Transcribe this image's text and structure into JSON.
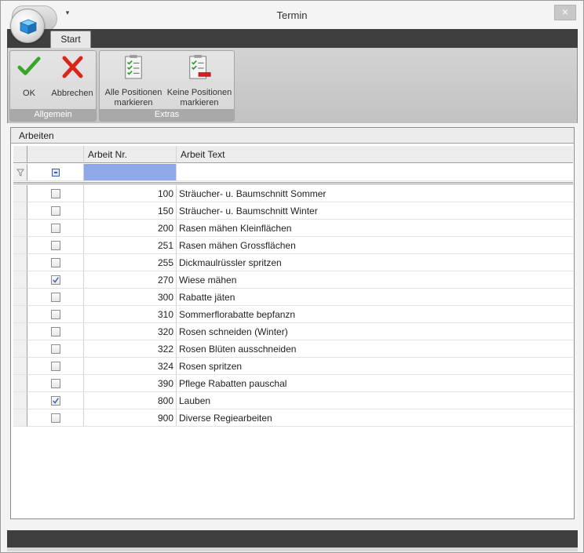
{
  "window": {
    "title": "Termin",
    "close_glyph": "×",
    "qat_glyph": "▾"
  },
  "ribbon": {
    "tabs": [
      {
        "label": "Start"
      }
    ],
    "groups": [
      {
        "caption": "Allgemein",
        "buttons": [
          {
            "label": "OK",
            "icon": "check-icon"
          },
          {
            "label": "Abbrechen",
            "icon": "cross-icon"
          }
        ]
      },
      {
        "caption": "Extras",
        "buttons": [
          {
            "label": "Alle Positionen markieren",
            "line1": "Alle Positionen",
            "line2": "markieren",
            "icon": "checklist-icon"
          },
          {
            "label": "Keine Positionen markieren",
            "line1": "Keine Positionen",
            "line2": "markieren",
            "icon": "checklist-minus-icon"
          }
        ]
      }
    ]
  },
  "panel": {
    "title": "Arbeiten"
  },
  "grid": {
    "columns": [
      "",
      "",
      "Arbeit Nr.",
      "Arbeit Text"
    ],
    "rows": [
      {
        "nr": "100",
        "text": "Sträucher- u. Baumschnitt Sommer",
        "checked": false
      },
      {
        "nr": "150",
        "text": "Sträucher- u. Baumschnitt Winter",
        "checked": false
      },
      {
        "nr": "200",
        "text": "Rasen mähen Kleinflächen",
        "checked": false
      },
      {
        "nr": "251",
        "text": "Rasen mähen Grossflächen",
        "checked": false
      },
      {
        "nr": "255",
        "text": "Dickmaulrüssler spritzen",
        "checked": false
      },
      {
        "nr": "270",
        "text": "Wiese mähen",
        "checked": true
      },
      {
        "nr": "300",
        "text": "Rabatte jäten",
        "checked": false
      },
      {
        "nr": "310",
        "text": "Sommerflorabatte bepfanzn",
        "checked": false
      },
      {
        "nr": "320",
        "text": "Rosen schneiden (Winter)",
        "checked": false
      },
      {
        "nr": "322",
        "text": "Rosen Blüten ausschneiden",
        "checked": false
      },
      {
        "nr": "324",
        "text": "Rosen spritzen",
        "checked": false
      },
      {
        "nr": "390",
        "text": "Pflege Rabatten pauschal",
        "checked": false
      },
      {
        "nr": "800",
        "text": "Lauben",
        "checked": true
      },
      {
        "nr": "900",
        "text": "Diverse Regiearbeiten",
        "checked": false
      }
    ]
  },
  "colors": {
    "ribbon_dark": "#3f3f3f",
    "filter_highlight": "#8fa9e8",
    "ok_green": "#3aa52b",
    "cancel_red": "#d9261c"
  }
}
